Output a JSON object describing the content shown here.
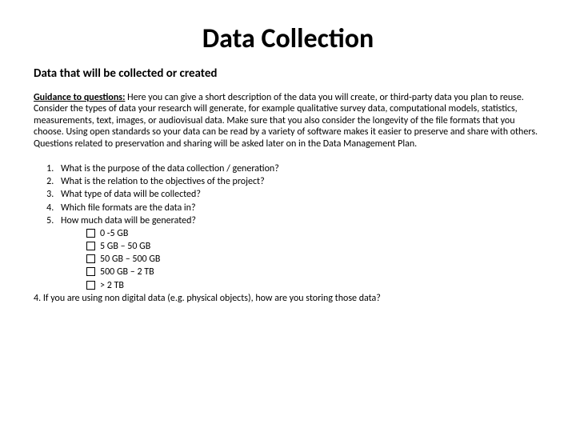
{
  "title": "Data Collection",
  "subtitle": "Data that will be collected or created",
  "guidance": {
    "lead": "Guidance to questions:",
    "body": " Here you can give a short description of the data you will create, or third-party data you plan to reuse. Consider the types of data your research will generate, for example qualitative survey data, computational models, statistics, measurements, text, images, or audiovisual data. Make sure that you also consider the longevity of the file formats that you choose. Using open standards so your data can be read by a variety of software makes it easier to preserve and share with others. Questions related to preservation and sharing will be asked later on in the Data Management Plan."
  },
  "questions": [
    "What is the purpose of the data collection / generation?",
    "What is the relation to the objectives of the project?",
    "What type of data will be collected?",
    "Which file formats are the data in?",
    "How much data will be generated?"
  ],
  "size_options": [
    "0 -5 GB",
    "5 GB – 50 GB",
    "50 GB – 500 GB",
    "500 GB – 2 TB",
    "> 2 TB"
  ],
  "footnote": "4. If you are using non digital data (e.g. physical objects), how are you storing those data?"
}
